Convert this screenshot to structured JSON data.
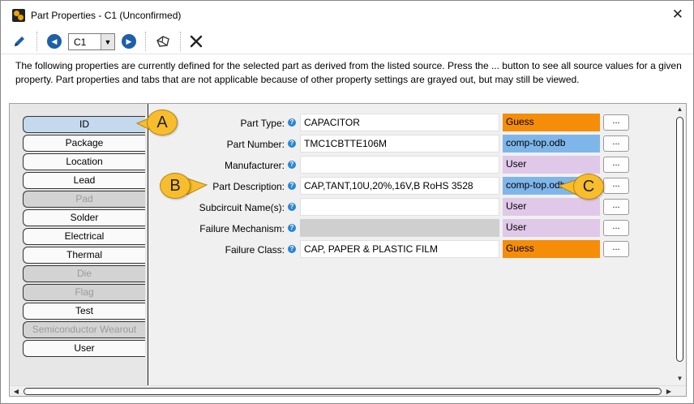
{
  "window": {
    "title": "Part Properties - C1 (Unconfirmed)",
    "close_glyph": "✕"
  },
  "toolbar": {
    "combo_value": "C1",
    "combo_arrow": "▼",
    "prev_glyph": "◀",
    "next_glyph": "▶"
  },
  "description": "The following properties are currently defined for the selected part as derived from the listed source. Press the ... button to see all source values for a given property. Part properties and tabs that are not applicable because of other property settings are grayed out, but may still be viewed.",
  "tabs": [
    {
      "label": "ID",
      "state": "active"
    },
    {
      "label": "Package",
      "state": "normal"
    },
    {
      "label": "Location",
      "state": "normal"
    },
    {
      "label": "Lead",
      "state": "normal"
    },
    {
      "label": "Pad",
      "state": "disabled"
    },
    {
      "label": "Solder",
      "state": "normal"
    },
    {
      "label": "Electrical",
      "state": "normal"
    },
    {
      "label": "Thermal",
      "state": "normal"
    },
    {
      "label": "Die",
      "state": "disabled"
    },
    {
      "label": "Flag",
      "state": "disabled"
    },
    {
      "label": "Test",
      "state": "normal"
    },
    {
      "label": "Semiconductor Wearout",
      "state": "disabled"
    },
    {
      "label": "User",
      "state": "normal"
    }
  ],
  "help_glyph": "?",
  "dots_label": "...",
  "properties": [
    {
      "label": "Part Type:",
      "value": "CAPACITOR",
      "source": "Guess",
      "source_kind": "guess",
      "disabled": false
    },
    {
      "label": "Part Number:",
      "value": "TMC1CBTTE106M",
      "source": "comp-top.odb",
      "source_kind": "file",
      "disabled": false
    },
    {
      "label": "Manufacturer:",
      "value": "",
      "source": "User",
      "source_kind": "user",
      "disabled": false
    },
    {
      "label": "Part Description:",
      "value": "CAP,TANT,10U,20%,16V,B RoHS 3528",
      "source": "comp-top.odb",
      "source_kind": "file",
      "disabled": false
    },
    {
      "label": "Subcircuit Name(s):",
      "value": "",
      "source": "User",
      "source_kind": "user",
      "disabled": false
    },
    {
      "label": "Failure Mechanism:",
      "value": "",
      "source": "User",
      "source_kind": "user",
      "disabled": true
    },
    {
      "label": "Failure Class:",
      "value": "CAP, PAPER & PLASTIC FILM",
      "source": "Guess",
      "source_kind": "guess",
      "disabled": false
    }
  ],
  "callouts": {
    "a": "A",
    "b": "B",
    "c": "C"
  },
  "colors": {
    "guess": "#f58d09",
    "file": "#7fb6ea",
    "user": "#e0c8e8",
    "active_tab": "#c5d9ee",
    "callout": "#f8bd2c"
  }
}
